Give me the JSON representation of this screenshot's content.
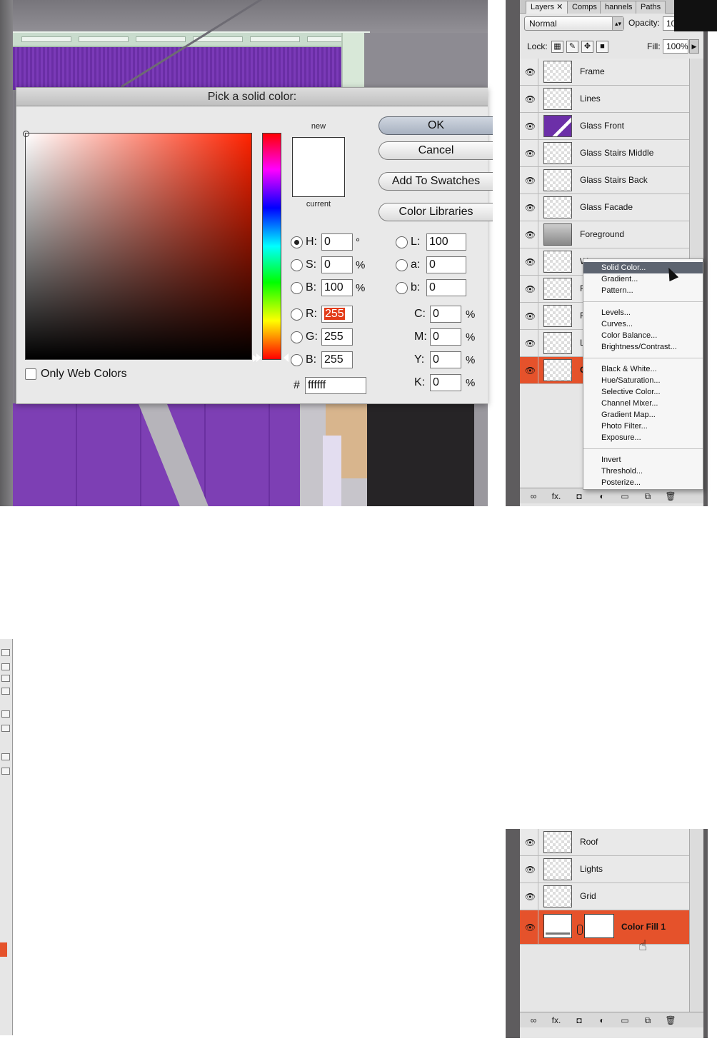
{
  "color_picker": {
    "title": "Pick a solid color:",
    "new_label": "new",
    "current_label": "current",
    "buttons": {
      "ok": "OK",
      "cancel": "Cancel",
      "add_to_swatches": "Add To Swatches",
      "color_libraries": "Color Libraries"
    },
    "hsb": {
      "h": {
        "label": "H:",
        "value": "0",
        "unit": "°"
      },
      "s": {
        "label": "S:",
        "value": "0",
        "unit": "%"
      },
      "b": {
        "label": "B:",
        "value": "100",
        "unit": "%"
      }
    },
    "rgb": {
      "r": {
        "label": "R:",
        "value": "255"
      },
      "g": {
        "label": "G:",
        "value": "255"
      },
      "b": {
        "label": "B:",
        "value": "255"
      }
    },
    "lab": {
      "l": {
        "label": "L:",
        "value": "100"
      },
      "a": {
        "label": "a:",
        "value": "0"
      },
      "b": {
        "label": "b:",
        "value": "0"
      }
    },
    "cmyk": {
      "c": {
        "label": "C:",
        "value": "0",
        "unit": "%"
      },
      "m": {
        "label": "M:",
        "value": "0",
        "unit": "%"
      },
      "y": {
        "label": "Y:",
        "value": "0",
        "unit": "%"
      },
      "k": {
        "label": "K:",
        "value": "0",
        "unit": "%"
      }
    },
    "hex_label": "#",
    "hex_value": "ffffff",
    "only_web_colors": "Only Web Colors",
    "new_color": "#ffffff"
  },
  "layers_panel": {
    "tabs": [
      "Layers",
      "Comps",
      "hannels",
      "Paths"
    ],
    "blend_mode": "Normal",
    "opacity_label": "Opacity:",
    "opacity_value": "10",
    "lock_label": "Lock:",
    "fill_label": "Fill:",
    "fill_value": "100%",
    "layers": [
      "Frame",
      "Lines",
      "Glass Front",
      "Glass Stairs Middle",
      "Glass Stairs Back",
      "Glass Facade",
      "Foreground",
      "W",
      "F",
      "F",
      "L",
      "C"
    ],
    "bottom_icons": [
      "∞",
      "fx.",
      "◘",
      "◐",
      "▭",
      "⧉",
      "🗑"
    ]
  },
  "context_menu": {
    "items": [
      "Solid Color...",
      "Gradient...",
      "Pattern...",
      "Levels...",
      "Curves...",
      "Color Balance...",
      "Brightness/Contrast...",
      "Black & White...",
      "Hue/Saturation...",
      "Selective Color...",
      "Channel Mixer...",
      "Gradient Map...",
      "Photo Filter...",
      "Exposure...",
      "Invert",
      "Threshold...",
      "Posterize..."
    ],
    "highlighted": "Solid Color..."
  },
  "layers_panel_bottom": {
    "layers": [
      "Roof",
      "Lights",
      "Grid"
    ],
    "color_fill_layer": "Color Fill 1",
    "selection_color": "#e5522b"
  }
}
